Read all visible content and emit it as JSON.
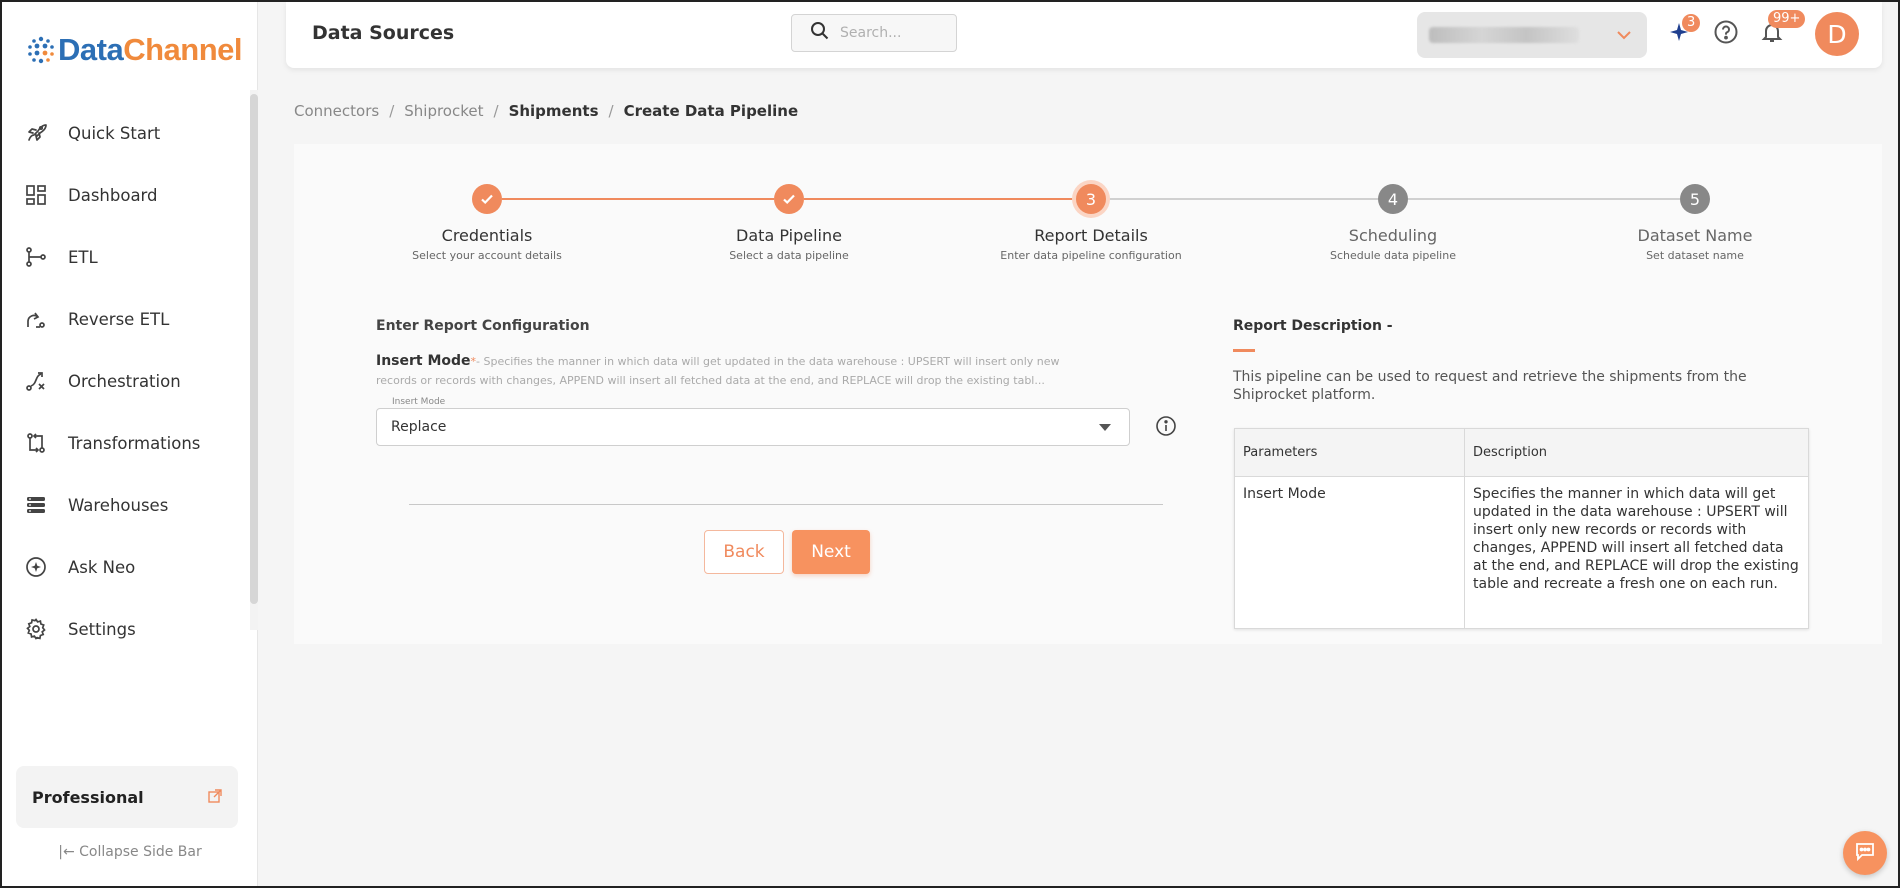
{
  "brand": {
    "name_part1": "Data",
    "name_part2": "Channel",
    "primary": "#2c6fb5",
    "accent": "#f08a3c"
  },
  "header": {
    "title": "Data Sources",
    "search_placeholder": "Search...",
    "sparkle_badge": "3",
    "notification_badge": "99+",
    "avatar_initial": "D"
  },
  "sidebar": {
    "items": [
      {
        "label": "Quick Start",
        "icon": "rocket-icon"
      },
      {
        "label": "Dashboard",
        "icon": "dashboard-icon"
      },
      {
        "label": "ETL",
        "icon": "etl-icon"
      },
      {
        "label": "Reverse ETL",
        "icon": "reverse-etl-icon"
      },
      {
        "label": "Orchestration",
        "icon": "orchestration-icon"
      },
      {
        "label": "Transformations",
        "icon": "transformations-icon"
      },
      {
        "label": "Warehouses",
        "icon": "warehouses-icon"
      },
      {
        "label": "Ask Neo",
        "icon": "ask-neo-icon"
      },
      {
        "label": "Settings",
        "icon": "gear-icon"
      }
    ],
    "plan": "Professional",
    "collapse_label": "Collapse Side Bar"
  },
  "breadcrumb": [
    "Connectors",
    "Shiprocket",
    "Shipments",
    "Create Data Pipeline"
  ],
  "stepper": {
    "steps": [
      {
        "number": "1",
        "title": "Credentials",
        "subtitle": "Select your account details",
        "state": "done"
      },
      {
        "number": "2",
        "title": "Data Pipeline",
        "subtitle": "Select a data pipeline",
        "state": "done"
      },
      {
        "number": "3",
        "title": "Report Details",
        "subtitle": "Enter data pipeline configuration",
        "state": "active"
      },
      {
        "number": "4",
        "title": "Scheduling",
        "subtitle": "Schedule data pipeline",
        "state": "todo"
      },
      {
        "number": "5",
        "title": "Dataset Name",
        "subtitle": "Set dataset name",
        "state": "todo"
      }
    ]
  },
  "form": {
    "title": "Enter Report Configuration",
    "insert_mode_label": "Insert Mode",
    "required_mark": "*",
    "insert_mode_help": "- Specifies the manner in which data will get updated in the data warehouse : UPSERT will insert only new records or records with changes, APPEND will insert all fetched data at the end, and REPLACE will drop the existing tabl...",
    "select_floating_label": "Insert Mode",
    "select_value": "Replace",
    "back_label": "Back",
    "next_label": "Next"
  },
  "description": {
    "title": "Report Description -",
    "text": "This pipeline can be used to request and retrieve the shipments from the Shiprocket platform.",
    "table_headers": [
      "Parameters",
      "Description"
    ],
    "table_rows": [
      [
        "Insert Mode",
        "Specifies the manner in which data will get updated in the data warehouse : UPSERT will insert only new records or records with changes, APPEND will insert all fetched data at the end, and REPLACE will drop the existing table and recreate a fresh one on each run."
      ]
    ]
  },
  "colors": {
    "accent": "#f08a5d",
    "muted_step": "#888888"
  }
}
